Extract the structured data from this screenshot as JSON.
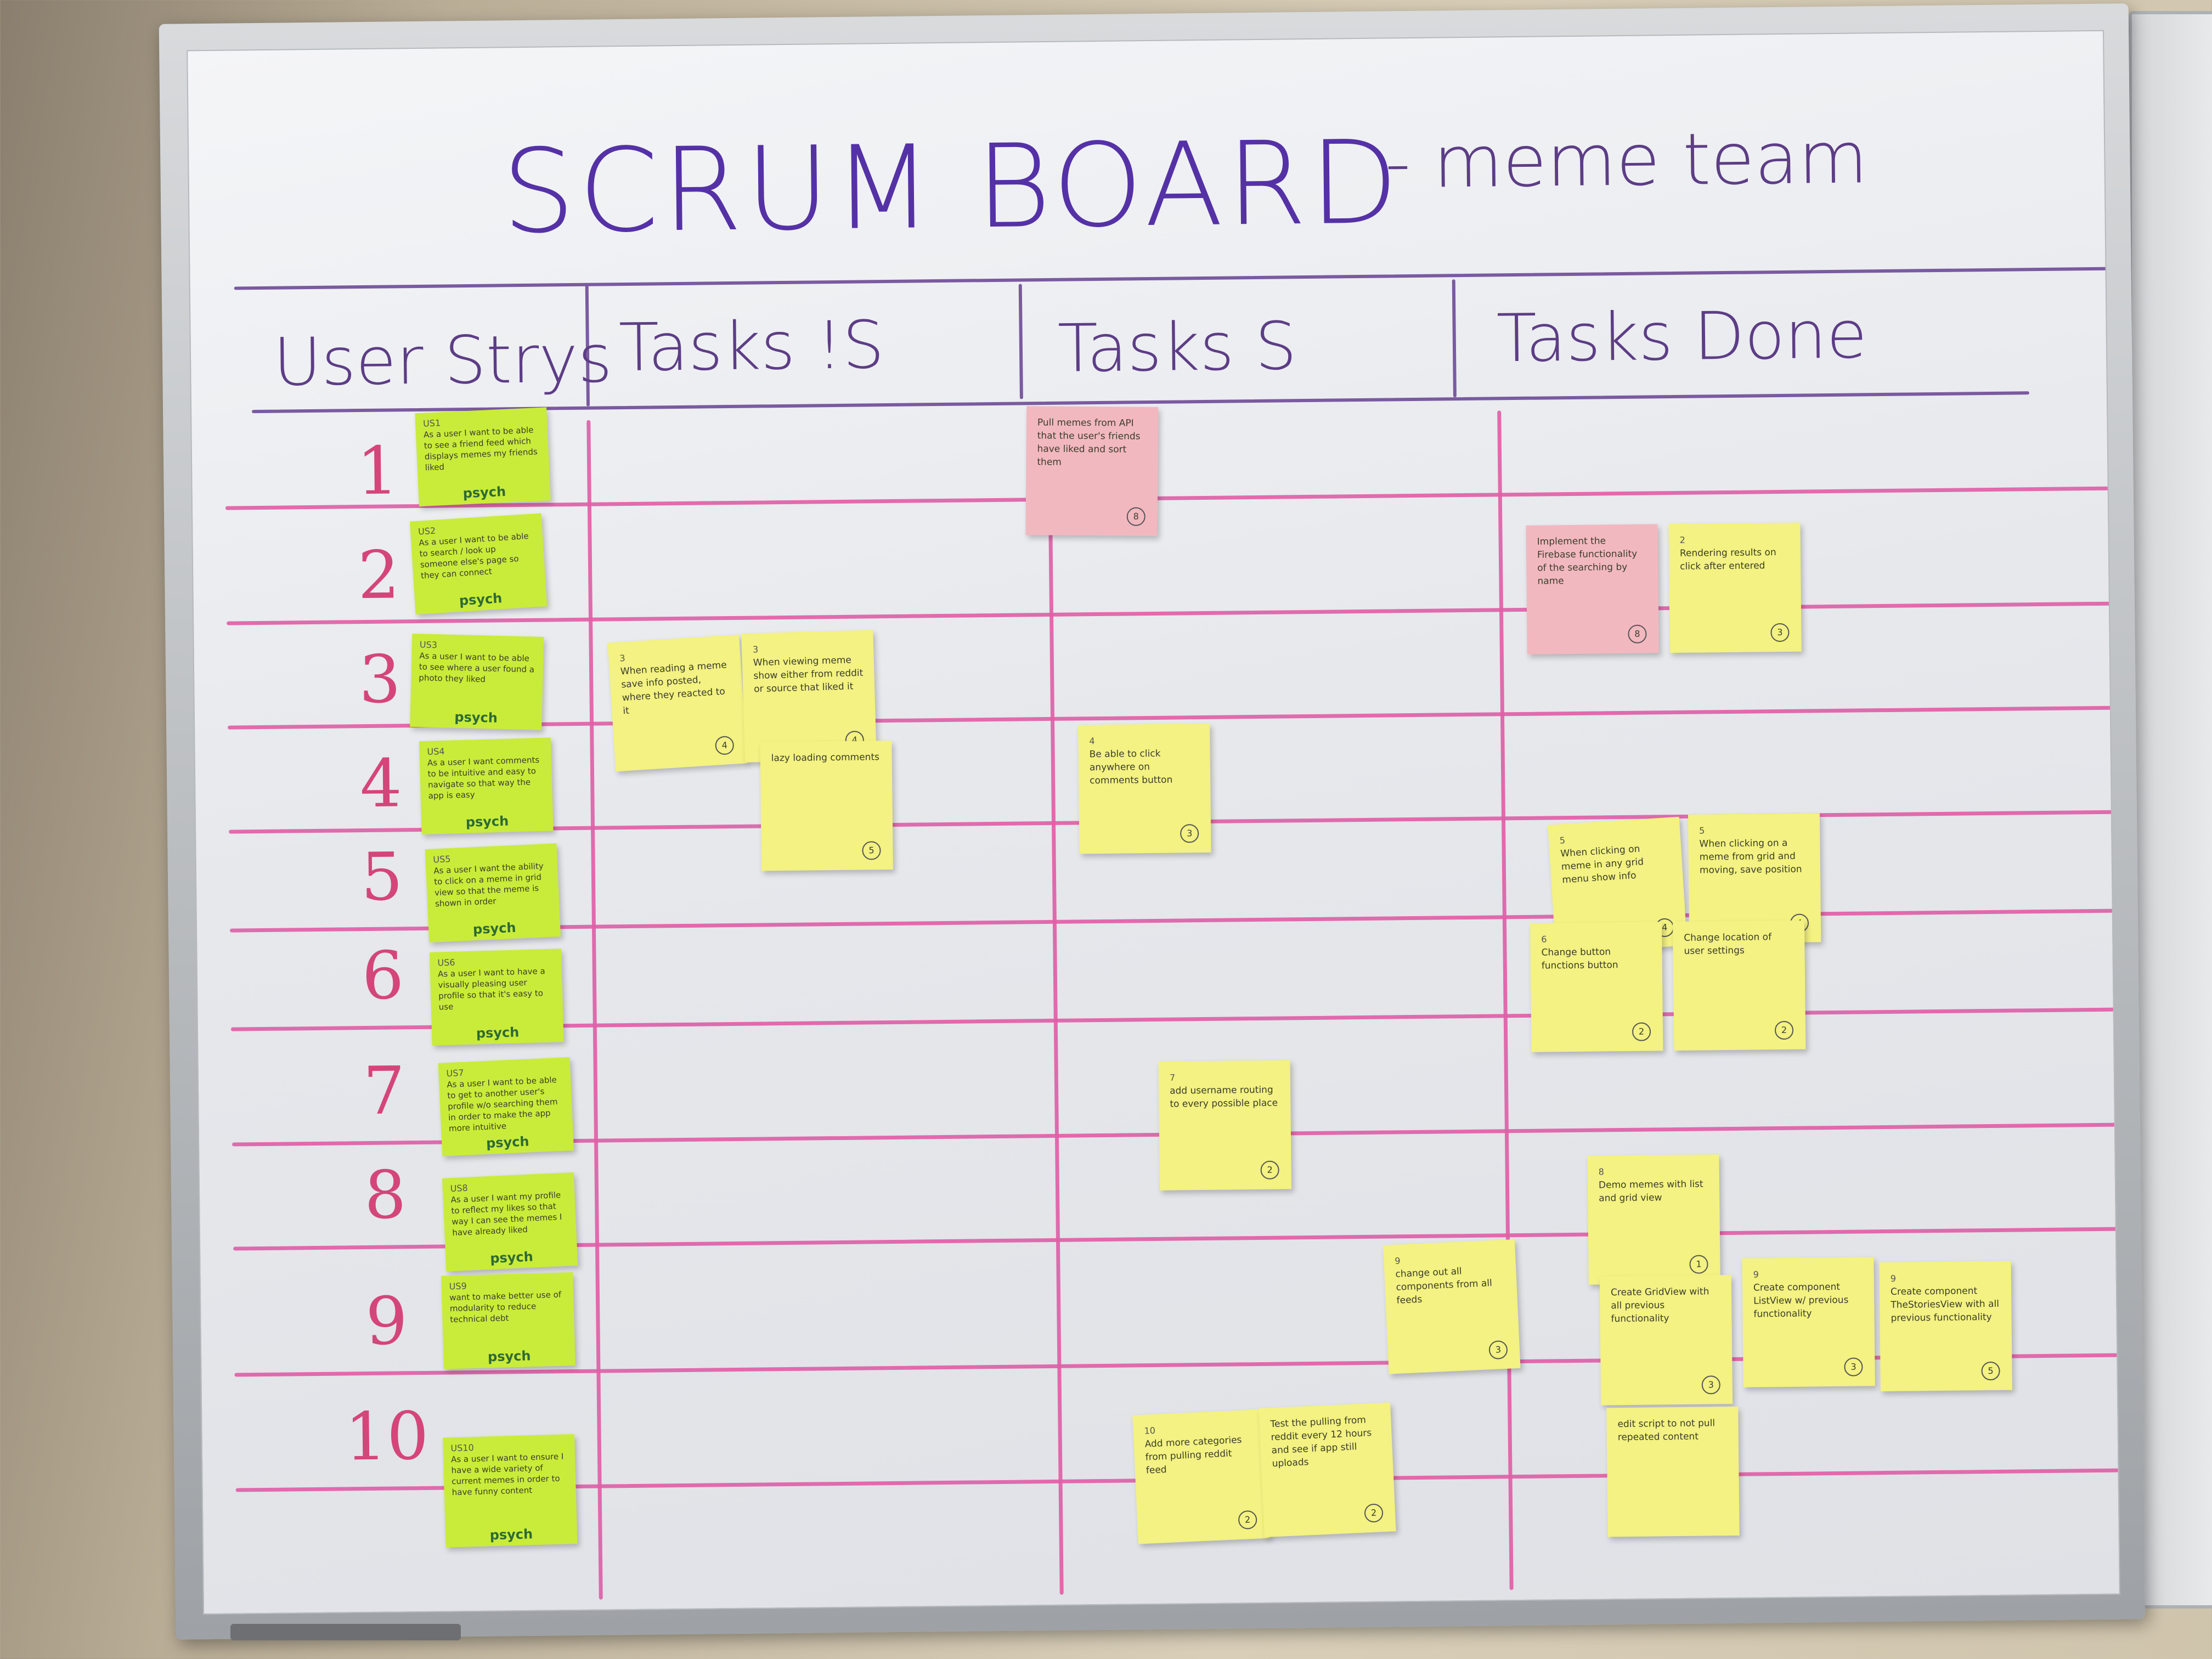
{
  "board": {
    "title": "SCRUM BOARD",
    "subtitle": "- meme team",
    "columns": [
      "User Strys",
      "Tasks !S",
      "Tasks S",
      "Tasks Done"
    ],
    "rows": [
      "1",
      "2",
      "3",
      "4",
      "5",
      "6",
      "7",
      "8",
      "9",
      "10"
    ]
  },
  "stories": [
    {
      "id": "US1",
      "text": "As a user I want to be able to see a friend feed which displays memes my friends liked",
      "brand": "psych"
    },
    {
      "id": "US2",
      "text": "As a user I want to be able to search / look up someone else's page so they can connect",
      "brand": "psych"
    },
    {
      "id": "US3",
      "text": "As a user I want to be able to see where a user found a photo they liked",
      "brand": "psych"
    },
    {
      "id": "US4",
      "text": "As a user I want comments to be intuitive and easy to navigate so that way the app is easy",
      "brand": "psych"
    },
    {
      "id": "US5",
      "text": "As a user I want the ability to click on a meme in grid view so that the meme is shown in order",
      "brand": "psych"
    },
    {
      "id": "US6",
      "text": "As a user I want to have a visually pleasing user profile so that it's easy to use",
      "brand": "psych"
    },
    {
      "id": "US7",
      "text": "As a user I want to be able to get to another user's profile w/o searching them in order to make the app more intuitive",
      "brand": "psych"
    },
    {
      "id": "US8",
      "text": "As a user I want my profile to reflect my likes so that way I can see the memes I have already liked",
      "brand": "psych"
    },
    {
      "id": "US9",
      "text": "want to make better use of modularity to reduce technical debt",
      "brand": "psych"
    },
    {
      "id": "US10",
      "text": "As a user I want to ensure I have a wide variety of current memes in order to have funny content",
      "brand": "psych"
    }
  ],
  "tasks": [
    {
      "id": "t-pull",
      "num": "",
      "text": "Pull memes from API that the user's friends have liked and sort them",
      "pts": "8",
      "color": "pink"
    },
    {
      "id": "t-reading",
      "num": "3",
      "text": "When reading a meme save info posted, where they reacted to it",
      "pts": "4",
      "color": "yellow"
    },
    {
      "id": "t-viewing",
      "num": "3",
      "text": "When viewing meme show either from reddit or source that liked it",
      "pts": "4",
      "color": "yellow"
    },
    {
      "id": "t-lazy",
      "num": "",
      "text": "lazy loading comments",
      "pts": "5",
      "color": "yellow"
    },
    {
      "id": "t-click",
      "num": "4",
      "text": "Be able to click anywhere on comments button",
      "pts": "3",
      "color": "yellow"
    },
    {
      "id": "t-username",
      "num": "7",
      "text": "add username routing to every possible place",
      "pts": "2",
      "color": "yellow"
    },
    {
      "id": "t-changeout",
      "num": "9",
      "text": "change out all components from all feeds",
      "pts": "3",
      "color": "yellow"
    },
    {
      "id": "t-categories",
      "num": "10",
      "text": "Add more categories from pulling reddit feed",
      "pts": "2",
      "color": "yellow"
    },
    {
      "id": "t-testpull",
      "num": "",
      "text": "Test the pulling from reddit every 12 hours and see if app still uploads",
      "pts": "2",
      "color": "yellow"
    },
    {
      "id": "d-implement",
      "num": "",
      "text": "Implement the Firebase functionality of the searching by name",
      "pts": "8",
      "color": "pink"
    },
    {
      "id": "d-rendering",
      "num": "2",
      "text": "Rendering results on click after entered",
      "pts": "3",
      "color": "yellow"
    },
    {
      "id": "d-clicking",
      "num": "5",
      "text": "When clicking on meme in any grid menu show info",
      "pts": "4",
      "color": "yellow"
    },
    {
      "id": "d-clicking2",
      "num": "5",
      "text": "When clicking on a meme from grid and moving, save position",
      "pts": "4",
      "color": "yellow"
    },
    {
      "id": "d-change1",
      "num": "6",
      "text": "Change button functions button",
      "pts": "2",
      "color": "yellow"
    },
    {
      "id": "d-change2",
      "num": "",
      "text": "Change location of user settings",
      "pts": "2",
      "color": "yellow"
    },
    {
      "id": "d-demo",
      "num": "8",
      "text": "Demo memes with list and grid view",
      "pts": "1",
      "color": "yellow"
    },
    {
      "id": "d-gridview",
      "num": "",
      "text": "Create GridView with all previous functionality",
      "pts": "3",
      "color": "yellow"
    },
    {
      "id": "d-listview",
      "num": "9",
      "text": "Create component ListView w/ previous functionality",
      "pts": "3",
      "color": "yellow"
    },
    {
      "id": "d-storiesview",
      "num": "9",
      "text": "Create component TheStoriesView with all previous functionality",
      "pts": "5",
      "color": "yellow"
    },
    {
      "id": "d-script",
      "num": "",
      "text": "edit script to not pull repeated content",
      "pts": "",
      "color": "yellow"
    }
  ]
}
